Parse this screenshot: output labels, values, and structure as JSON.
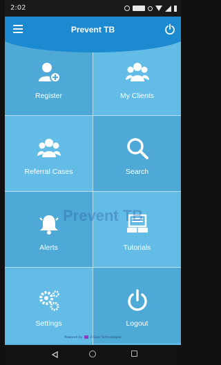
{
  "status_bar": {
    "time": "2:02"
  },
  "header": {
    "title": "Prevent TB"
  },
  "tiles": [
    {
      "label": "Register",
      "icon": "register-user-icon"
    },
    {
      "label": "My Clients",
      "icon": "clients-group-icon"
    },
    {
      "label": "Referral Cases",
      "icon": "referral-group-icon"
    },
    {
      "label": "Search",
      "icon": "search-icon"
    },
    {
      "label": "Alerts",
      "icon": "bell-icon"
    },
    {
      "label": "Tutorials",
      "icon": "book-icon"
    },
    {
      "label": "Settings",
      "icon": "gears-icon"
    },
    {
      "label": "Logout",
      "icon": "power-icon"
    }
  ],
  "watermark": "Prevent TB",
  "footer": {
    "powered_text": "Powered by",
    "company": "Z-Sure Technologies"
  },
  "colors": {
    "primary": "#1b8ad0",
    "tile_dark": "#4ea9d6",
    "tile_light": "#62bce6"
  }
}
